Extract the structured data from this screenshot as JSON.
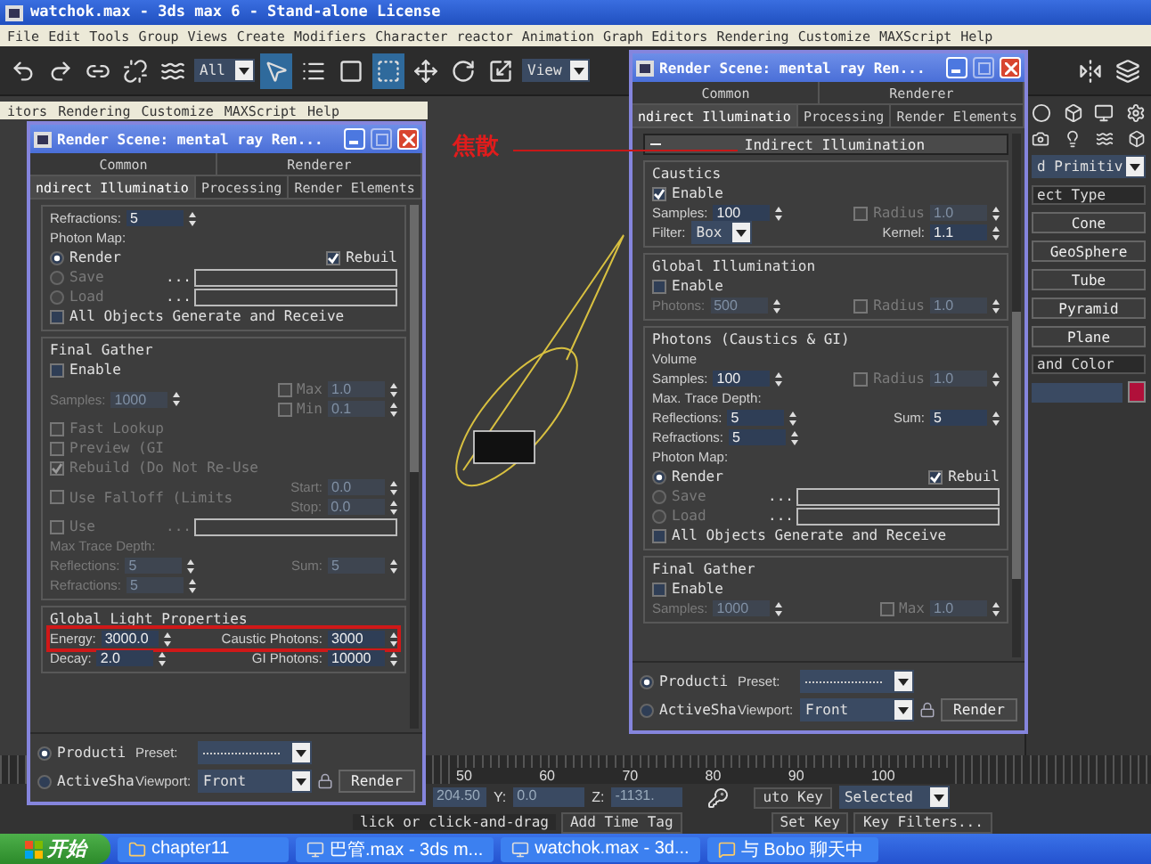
{
  "app": {
    "title": "watchok.max - 3ds max 6 - Stand-alone License",
    "menu": [
      "File",
      "Edit",
      "Tools",
      "Group",
      "Views",
      "Create",
      "Modifiers",
      "Character",
      "reactor",
      "Animation",
      "Graph Editors",
      "Rendering",
      "Customize",
      "MAXScript",
      "Help"
    ],
    "selection_filter": "All",
    "coord_system": "View"
  },
  "back_menu": [
    "itors",
    "Rendering",
    "Customize",
    "MAXScript",
    "Help"
  ],
  "windows": [
    {
      "title": "Render Scene: mental ray Ren...",
      "tab_rows": [
        [
          {
            "label": "Common",
            "selected": false
          },
          {
            "label": "Renderer",
            "selected": false
          }
        ],
        [
          {
            "label": "ndirect Illuminatio",
            "selected": true
          },
          {
            "label": "Processing",
            "selected": false
          },
          {
            "label": "Render Elements",
            "selected": false
          }
        ]
      ],
      "groups": [
        {
          "rows": [
            {
              "items": [
                {
                  "kind": "spinner",
                  "label": "Refractions:",
                  "value": "5",
                  "disabled": false
                }
              ]
            },
            {
              "items": [
                {
                  "kind": "text",
                  "text": "Photon Map:",
                  "disabled": false
                }
              ]
            },
            {
              "items": [
                {
                  "kind": "radio",
                  "label": "Render",
                  "selected": true,
                  "disabled": false
                },
                {
                  "kind": "check",
                  "label": "Rebuil",
                  "checked": true,
                  "disabled": false
                }
              ]
            },
            {
              "items": [
                {
                  "kind": "radio",
                  "label": "Save",
                  "selected": false,
                  "disabled": true
                },
                {
                  "kind": "file",
                  "button": "...",
                  "disabled": false
                }
              ]
            },
            {
              "items": [
                {
                  "kind": "radio",
                  "label": "Load",
                  "selected": false,
                  "disabled": true
                },
                {
                  "kind": "file",
                  "button": "...",
                  "disabled": false
                }
              ]
            },
            {
              "items": [
                {
                  "kind": "check",
                  "label": "All Objects Generate and Receive",
                  "checked": false,
                  "disabled": false
                }
              ]
            }
          ]
        },
        {
          "title": "Final Gather",
          "rows": [
            {
              "items": [
                {
                  "kind": "check",
                  "label": "Enable",
                  "checked": false,
                  "disabled": false
                }
              ]
            },
            {
              "items": [
                {
                  "kind": "spinner",
                  "label": "Samples:",
                  "value": "1000",
                  "disabled": true
                },
                {
                  "kind": "stack",
                  "items": [
                    {
                      "kind": "checkspinner",
                      "label": "Max",
                      "checked": false,
                      "value": "1.0",
                      "disabled": true
                    },
                    {
                      "kind": "checkspinner",
                      "label": "Min",
                      "checked": false,
                      "value": "0.1",
                      "disabled": true
                    }
                  ]
                }
              ]
            },
            {
              "items": [
                {
                  "kind": "check",
                  "label": "Fast Lookup",
                  "checked": false,
                  "disabled": true
                }
              ]
            },
            {
              "items": [
                {
                  "kind": "check",
                  "label": "Preview (GI",
                  "checked": false,
                  "disabled": true
                }
              ]
            },
            {
              "items": [
                {
                  "kind": "check",
                  "label": "Rebuild (Do Not Re-Use",
                  "checked": true,
                  "disabled": true
                }
              ]
            },
            {
              "items": [
                {
                  "kind": "check",
                  "label": "Use Falloff (Limits",
                  "checked": false,
                  "disabled": true
                },
                {
                  "kind": "stack",
                  "items": [
                    {
                      "kind": "spinner",
                      "label": "Start:",
                      "value": "0.0",
                      "disabled": true
                    },
                    {
                      "kind": "spinner",
                      "label": "Stop:",
                      "value": "0.0",
                      "disabled": true
                    }
                  ]
                }
              ]
            },
            {
              "items": [
                {
                  "kind": "check",
                  "label": "Use",
                  "checked": false,
                  "disabled": true
                },
                {
                  "kind": "file",
                  "button": "...",
                  "disabled": true
                }
              ]
            },
            {
              "items": [
                {
                  "kind": "text",
                  "text": "Max Trace Depth:",
                  "disabled": true
                }
              ]
            },
            {
              "items": [
                {
                  "kind": "spinner",
                  "label": "Reflections:",
                  "value": "5",
                  "disabled": true
                },
                {
                  "kind": "spinner",
                  "label": "Sum:",
                  "value": "5",
                  "disabled": true
                }
              ]
            },
            {
              "items": [
                {
                  "kind": "spinner",
                  "label": "Refractions:",
                  "value": "5",
                  "disabled": true
                }
              ]
            }
          ]
        },
        {
          "title": "Global Light Properties",
          "rows": [
            {
              "highlighted": true,
              "items": [
                {
                  "kind": "spinner",
                  "label": "Energy:",
                  "value": "3000.0",
                  "disabled": false
                },
                {
                  "kind": "spinner",
                  "label": "Caustic Photons:",
                  "value": "3000",
                  "disabled": false
                }
              ]
            },
            {
              "items": [
                {
                  "kind": "spinner",
                  "label": "Decay:",
                  "value": "2.0",
                  "disabled": false
                },
                {
                  "kind": "spinner",
                  "label": "GI Photons:",
                  "value": "10000",
                  "disabled": false
                }
              ]
            }
          ]
        }
      ],
      "footer": {
        "modes": [
          {
            "label": "Producti",
            "selected": true
          },
          {
            "label": "ActiveSha",
            "selected": false
          }
        ],
        "preset_label": "Preset:",
        "viewport_label": "Viewport:",
        "viewport": "Front",
        "render_button": "Render"
      }
    },
    {
      "title": "Render Scene: mental ray Ren...",
      "tab_rows": [
        [
          {
            "label": "Common",
            "selected": false
          },
          {
            "label": "Renderer",
            "selected": false
          }
        ],
        [
          {
            "label": "ndirect Illuminatio",
            "selected": true
          },
          {
            "label": "Processing",
            "selected": false
          },
          {
            "label": "Render Elements",
            "selected": false
          }
        ]
      ],
      "rollout": {
        "title": "Indirect Illumination",
        "expanded": true
      },
      "groups": [
        {
          "title": "Caustics",
          "rows": [
            {
              "items": [
                {
                  "kind": "check",
                  "label": "Enable",
                  "checked": true,
                  "disabled": false
                }
              ]
            },
            {
              "items": [
                {
                  "kind": "spinner",
                  "label": "Samples:",
                  "value": "100",
                  "disabled": false
                },
                {
                  "kind": "checkspinner",
                  "label": "Radius",
                  "checked": false,
                  "value": "1.0",
                  "disabled": true
                }
              ]
            },
            {
              "items": [
                {
                  "kind": "dropdown",
                  "label": "Filter:",
                  "value": "Box"
                },
                {
                  "kind": "spinner",
                  "label": "Kernel:",
                  "value": "1.1",
                  "disabled": false
                }
              ]
            }
          ]
        },
        {
          "title": "Global Illumination",
          "rows": [
            {
              "items": [
                {
                  "kind": "check",
                  "label": "Enable",
                  "checked": false,
                  "disabled": false
                }
              ]
            },
            {
              "items": [
                {
                  "kind": "spinner",
                  "label": "Photons:",
                  "value": "500",
                  "disabled": true
                },
                {
                  "kind": "checkspinner",
                  "label": "Radius",
                  "checked": false,
                  "value": "1.0",
                  "disabled": true
                }
              ]
            }
          ]
        },
        {
          "title": "Photons (Caustics & GI)",
          "rows": [
            {
              "items": [
                {
                  "kind": "text",
                  "text": "Volume",
                  "disabled": false
                }
              ]
            },
            {
              "items": [
                {
                  "kind": "spinner",
                  "label": "Samples:",
                  "value": "100",
                  "disabled": false
                },
                {
                  "kind": "checkspinner",
                  "label": "Radius",
                  "checked": false,
                  "value": "1.0",
                  "disabled": true
                }
              ]
            },
            {
              "items": [
                {
                  "kind": "text",
                  "text": "Max. Trace Depth:",
                  "disabled": false
                }
              ]
            },
            {
              "items": [
                {
                  "kind": "spinner",
                  "label": "Reflections:",
                  "value": "5",
                  "disabled": false
                },
                {
                  "kind": "spinner",
                  "label": "Sum:",
                  "value": "5",
                  "disabled": false
                }
              ]
            },
            {
              "items": [
                {
                  "kind": "spinner",
                  "label": "Refractions:",
                  "value": "5",
                  "disabled": false
                }
              ]
            },
            {
              "items": [
                {
                  "kind": "text",
                  "text": "Photon Map:",
                  "disabled": false
                }
              ]
            },
            {
              "items": [
                {
                  "kind": "radio",
                  "label": "Render",
                  "selected": true,
                  "disabled": false
                },
                {
                  "kind": "check",
                  "label": "Rebuil",
                  "checked": true,
                  "disabled": false
                }
              ]
            },
            {
              "items": [
                {
                  "kind": "radio",
                  "label": "Save",
                  "selected": false,
                  "disabled": true
                },
                {
                  "kind": "file",
                  "button": "...",
                  "disabled": false
                }
              ]
            },
            {
              "items": [
                {
                  "kind": "radio",
                  "label": "Load",
                  "selected": false,
                  "disabled": true
                },
                {
                  "kind": "file",
                  "button": "...",
                  "disabled": false
                }
              ]
            },
            {
              "items": [
                {
                  "kind": "check",
                  "label": "All Objects Generate and Receive",
                  "checked": false,
                  "disabled": false
                }
              ]
            }
          ]
        },
        {
          "title": "Final Gather",
          "rows": [
            {
              "items": [
                {
                  "kind": "check",
                  "label": "Enable",
                  "checked": false,
                  "disabled": false
                }
              ]
            },
            {
              "items": [
                {
                  "kind": "spinner",
                  "label": "Samples:",
                  "value": "1000",
                  "disabled": true
                },
                {
                  "kind": "checkspinner",
                  "label": "Max",
                  "checked": false,
                  "value": "1.0",
                  "disabled": true
                }
              ]
            }
          ]
        }
      ],
      "footer": {
        "modes": [
          {
            "label": "Producti",
            "selected": true
          },
          {
            "label": "ActiveSha",
            "selected": false
          }
        ],
        "preset_label": "Preset:",
        "viewport_label": "Viewport:",
        "viewport": "Front",
        "render_button": "Render"
      }
    }
  ],
  "annotation": {
    "text": "焦散"
  },
  "command_panel": {
    "category": "d Primitiv",
    "rollouts": [
      {
        "title": "ect Type",
        "buttons": [
          "Cone",
          "GeoSphere",
          "Tube",
          "Pyramid",
          "Plane"
        ]
      },
      {
        "title": "and Color"
      }
    ]
  },
  "timeline": {
    "ticks": [
      "50",
      "60",
      "70",
      "80",
      "90",
      "100"
    ]
  },
  "status": {
    "x_value": "204.50",
    "y_label": "Y:",
    "y_value": "0.0",
    "z_label": "Z:",
    "z_value": "-1131.",
    "auto_key": "uto Key",
    "key_mode": "Selected",
    "prompt": "lick or click-and-drag",
    "add_time_tag": "Add Time Tag",
    "set_key": "Set Key",
    "key_filters": "Key Filters..."
  },
  "taskbar": {
    "start": "开始",
    "tasks": [
      {
        "kind": "folder",
        "label": "chapter11"
      },
      {
        "kind": "app",
        "label": "巴管.max - 3ds m..."
      },
      {
        "kind": "app",
        "label": "watchok.max - 3d..."
      },
      {
        "kind": "chat",
        "label": "与 Bobo 聊天中"
      }
    ]
  }
}
